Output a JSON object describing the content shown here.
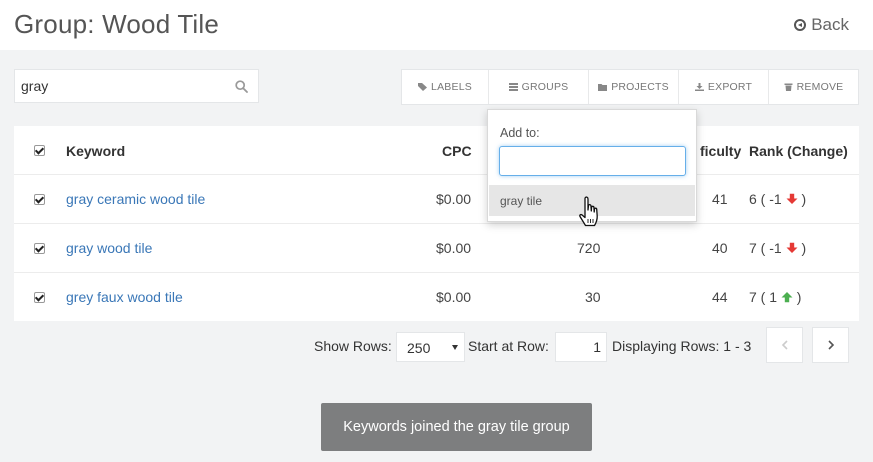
{
  "header": {
    "title": "Group: Wood Tile",
    "back_label": "Back"
  },
  "search": {
    "value": "gray",
    "placeholder": ""
  },
  "toolbar": {
    "labels": "LABELS",
    "groups": "GROUPS",
    "projects": "PROJECTS",
    "export": "EXPORT",
    "remove": "REMOVE"
  },
  "table": {
    "headers": {
      "keyword": "Keyword",
      "cpc": "CPC",
      "difficulty": "ficulty",
      "rank": "Rank (Change)"
    },
    "rows": [
      {
        "keyword": "gray ceramic wood tile",
        "cpc": "$0.00",
        "volume": "",
        "difficulty": "41",
        "rank": "6 ( -1",
        "change": "down",
        "close": ")"
      },
      {
        "keyword": "gray wood tile",
        "cpc": "$0.00",
        "volume": "720",
        "difficulty": "40",
        "rank": "7 ( -1",
        "change": "down",
        "close": ")"
      },
      {
        "keyword": "grey faux wood tile",
        "cpc": "$0.00",
        "volume": "30",
        "difficulty": "44",
        "rank": "7 ( 1",
        "change": "up",
        "close": ")"
      }
    ]
  },
  "dropdown": {
    "label": "Add to:",
    "input_value": "",
    "option": "gray tile"
  },
  "pager": {
    "show_rows_label": "Show Rows:",
    "rows_value": "250",
    "start_label": "Start at Row:",
    "start_value": "1",
    "displaying": "Displaying Rows: 1 - 3"
  },
  "toast": {
    "message": "Keywords joined the gray tile group"
  },
  "colors": {
    "link": "#3a77b7",
    "down": "#e53935",
    "up": "#4caf50",
    "focus": "#66afe9"
  }
}
